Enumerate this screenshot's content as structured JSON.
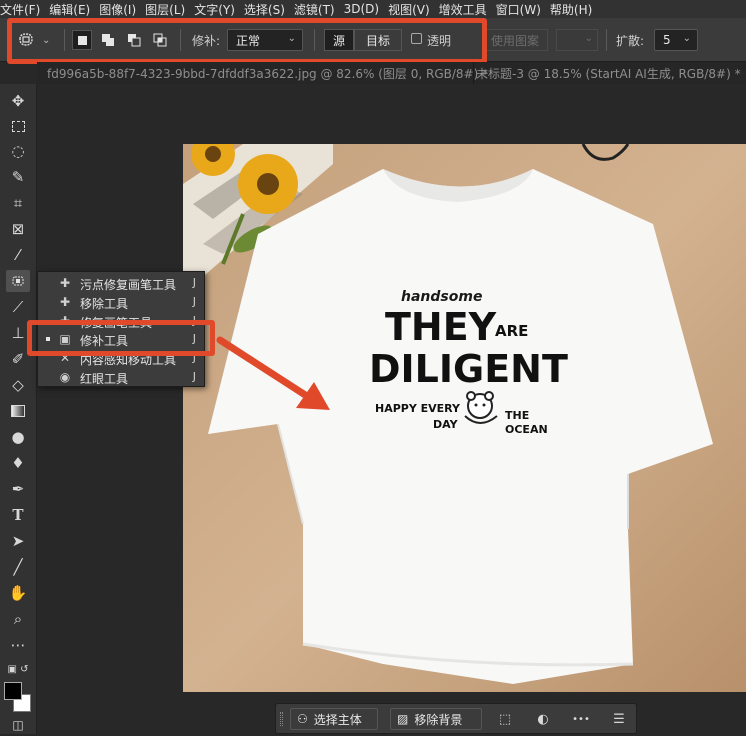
{
  "menu": [
    "文件(F)",
    "编辑(E)",
    "图像(I)",
    "图层(L)",
    "文字(Y)",
    "选择(S)",
    "滤镜(T)",
    "3D(D)",
    "视图(V)",
    "增效工具",
    "窗口(W)",
    "帮助(H)"
  ],
  "options": {
    "patch_label": "修补:",
    "patch_mode": "正常",
    "source_label": "源",
    "target_label": "目标",
    "transparent_label": "透明",
    "use_pattern_label": "使用图案",
    "diffusion_label": "扩散:",
    "diffusion_value": "5"
  },
  "tabs": [
    {
      "label": "fd996a5b-88f7-4323-9bbd-7dfddf3a3622.jpg @ 82.6% (图层 0, RGB/8#) *",
      "close": "×"
    },
    {
      "label": "未标题-3 @ 18.5% (StartAI AI生成, RGB/8#) *",
      "close": "×"
    }
  ],
  "flyout": {
    "items": [
      {
        "label": "污点修复画笔工具",
        "key": "J"
      },
      {
        "label": "移除工具",
        "key": "J"
      },
      {
        "label": "修复画笔工具",
        "key": "J"
      },
      {
        "label": "修补工具",
        "key": "J"
      },
      {
        "label": "内容感知移动工具",
        "key": "J"
      },
      {
        "label": "红眼工具",
        "key": "J"
      }
    ]
  },
  "shirt": {
    "line1": "handsome",
    "line2a": "THEY",
    "line2b": "ARE",
    "line3": "DILIGENT",
    "line4a": "HAPPY EVERY",
    "line4b": "DAY",
    "line5a": "THE",
    "line5b": "OCEAN"
  },
  "context": {
    "select_subject": "选择主体",
    "remove_bg": "移除背景",
    "more": "•••"
  },
  "colors": {
    "accent_red": "#e04a2a",
    "ui_bg": "#3b3b3b"
  }
}
